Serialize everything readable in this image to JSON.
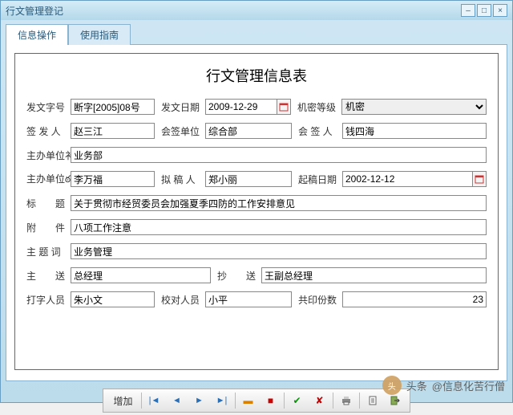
{
  "window": {
    "title": "行文管理登记"
  },
  "tabs": {
    "active": "信息操作",
    "inactive": "使用指南"
  },
  "form": {
    "title": "行文管理信息表",
    "labels": {
      "doc_no": "发文字号",
      "send_date": "发文日期",
      "secret": "机密等级",
      "signer": "签 发 人",
      "cosign_unit": "会签单位",
      "cosign_person": "会 签 人",
      "host_unit": "主办单位衤",
      "host_unit_e": "主办单位ఠ",
      "drafter": "拟 稿 人",
      "draft_date": "起稿日期",
      "subject": "标　　题",
      "attach": "附　　件",
      "keywords": "主 题 词",
      "main_send": "主　　送",
      "copy_send": "抄　　送",
      "typist": "打字人员",
      "proofreader": "校对人员",
      "copies": "共印份数"
    },
    "values": {
      "doc_no": "断字[2005]08号",
      "send_date": "2009-12-29",
      "secret": "机密",
      "signer": "赵三江",
      "cosign_unit": "综合部",
      "cosign_person": "钱四海",
      "host_unit": "业务部",
      "host_unit_e": "李万福",
      "drafter": "郑小丽",
      "draft_date": "2002-12-12",
      "subject": "关于贯彻市经贸委员会加强夏季四防的工作安排意见",
      "attach": "八项工作注意",
      "keywords": "业务管理",
      "main_send": "总经理",
      "copy_send": "王副总经理",
      "typist": "朱小文",
      "proofreader": "小平",
      "copies": "23"
    }
  },
  "toolbar": {
    "add": "增加"
  },
  "watermark": {
    "prefix": "头条",
    "author": "@信息化苦行僧"
  }
}
